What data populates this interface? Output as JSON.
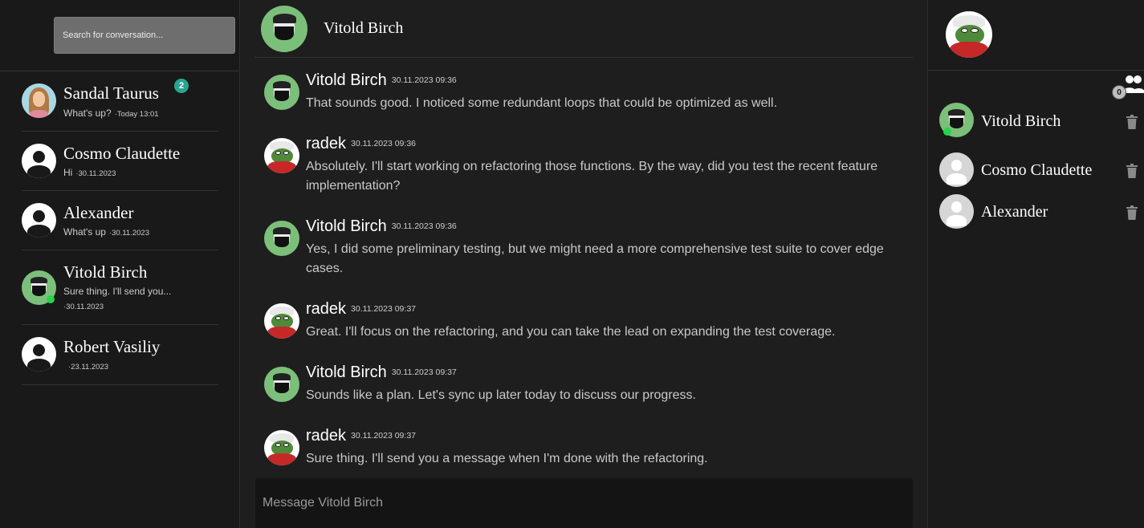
{
  "sidebar": {
    "search_placeholder": "Search for conversation...",
    "conversations": [
      {
        "name": "Sandal Taurus",
        "preview": "What's up?",
        "date": "·Today 13:01",
        "unread": "2"
      },
      {
        "name": "Cosmo Claudette",
        "preview": "Hi",
        "date": "·30.11.2023"
      },
      {
        "name": "Alexander",
        "preview": "What's up",
        "date": "·30.11.2023"
      },
      {
        "name": "Vitold Birch",
        "preview": "Sure thing. I'll send you...",
        "date": "·30.11.2023"
      },
      {
        "name": "Robert Vasiliy",
        "preview": "",
        "date": "·23.11.2023"
      }
    ]
  },
  "chat": {
    "title": "Vitold Birch",
    "messages": [
      {
        "author": "Vitold Birch",
        "time": "30.11.2023 09:36",
        "text": "That sounds good. I noticed some redundant loops that could be optimized as well."
      },
      {
        "author": "radek",
        "time": "30.11.2023 09:36",
        "text": "Absolutely. I'll start working on refactoring those functions. By the way, did you test the recent feature implementation?"
      },
      {
        "author": "Vitold Birch",
        "time": "30.11.2023 09:36",
        "text": "Yes, I did some preliminary testing, but we might need a more comprehensive test suite to cover edge cases."
      },
      {
        "author": "radek",
        "time": "30.11.2023 09:37",
        "text": "Great. I'll focus on the refactoring, and you can take the lead on expanding the test coverage."
      },
      {
        "author": "Vitold Birch",
        "time": "30.11.2023 09:37",
        "text": "Sounds like a plan. Let's sync up later today to discuss our progress."
      },
      {
        "author": "radek",
        "time": "30.11.2023 09:37",
        "text": "Sure thing. I'll send you a message when I'm done with the refactoring."
      }
    ],
    "composer_placeholder": "Message Vitold Birch"
  },
  "right_panel": {
    "friend_requests_count": "0",
    "members": [
      {
        "name": "Vitold Birch"
      },
      {
        "name": "Cosmo Claudette"
      },
      {
        "name": "Alexander"
      }
    ]
  },
  "colors": {
    "accent_badge": "#2aa58f",
    "online": "#27d44b",
    "avatar_green": "#7cbf7a"
  }
}
